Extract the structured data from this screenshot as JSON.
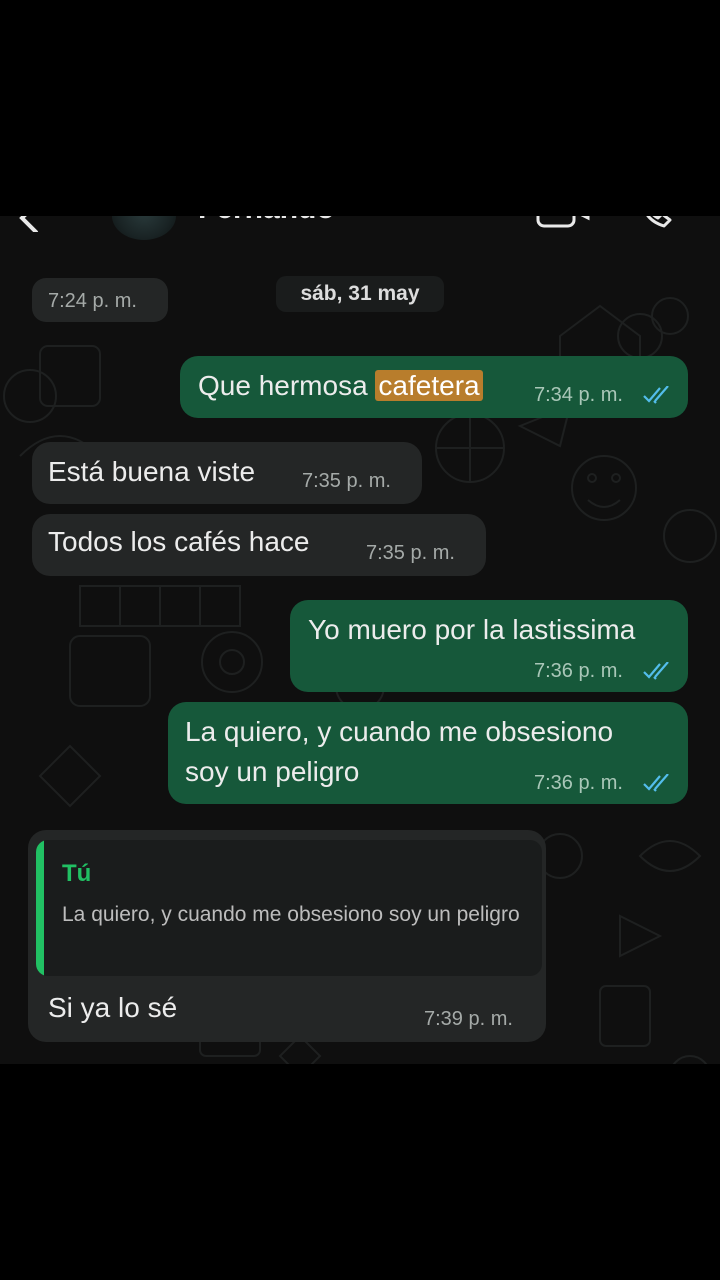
{
  "header": {
    "contact_name": "Fernando",
    "icons": [
      "back-icon",
      "video-call-icon",
      "voice-call-icon"
    ]
  },
  "date_separator": "sáb, 31 may",
  "messages": [
    {
      "direction": "incoming",
      "text": "",
      "time": "7:24 p. m."
    },
    {
      "direction": "outgoing",
      "text_before": "Que hermosa ",
      "highlight": "cafetera",
      "time": "7:34 p. m.",
      "status": "read"
    },
    {
      "direction": "incoming",
      "text": "Está buena viste",
      "time": "7:35 p. m."
    },
    {
      "direction": "incoming",
      "text": "Todos los cafés hace",
      "time": "7:35 p. m."
    },
    {
      "direction": "outgoing",
      "text": "Yo muero por la lastissima",
      "time": "7:36 p. m.",
      "status": "read"
    },
    {
      "direction": "outgoing",
      "line1": "La quiero, y cuando me obsesiono",
      "line2": "soy un peligro",
      "time": "7:36 p. m.",
      "status": "read"
    },
    {
      "direction": "incoming",
      "reply_author": "Tú",
      "reply_text": "La quiero, y cuando me obsesiono soy un peligro",
      "text": "Si ya lo sé",
      "time": "7:39 p. m."
    }
  ],
  "colors": {
    "incoming_bubble": "#242626",
    "outgoing_bubble": "#16583a",
    "read_ticks": "#53bdeb",
    "highlight": "#b87d2c",
    "reply_accent": "#21c063"
  }
}
